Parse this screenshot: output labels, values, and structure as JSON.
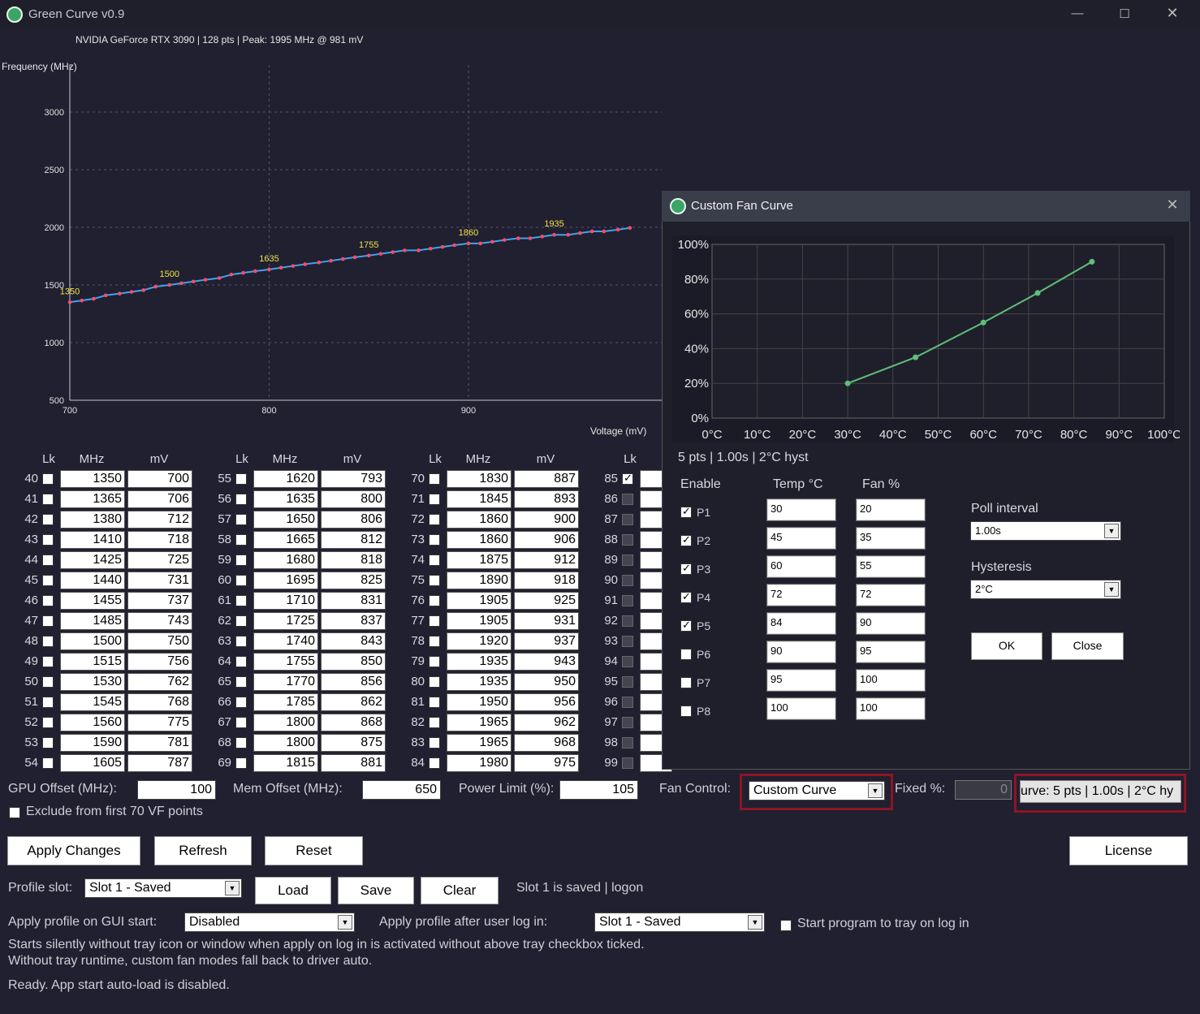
{
  "window": {
    "title": "Green Curve v0.9"
  },
  "info": "NVIDIA GeForce RTX 3090  |  128 pts  |  Peak: 1995 MHz @ 981 mV",
  "chart": {
    "ylabel": "Frequency (MHz)",
    "xlabel": "Voltage (mV)",
    "yticks": [
      "3000",
      "2500",
      "2000",
      "1500",
      "1000",
      "500"
    ],
    "xticks": [
      "700",
      "800",
      "900"
    ],
    "annotations": [
      "1350",
      "1500",
      "1635",
      "1755",
      "1860",
      "1935"
    ]
  },
  "chart_data": {
    "type": "line",
    "xlabel": "Voltage (mV)",
    "ylabel": "Frequency (MHz)",
    "xlim": [
      700,
      995
    ],
    "ylim": [
      500,
      3250
    ],
    "x": [
      700,
      706,
      712,
      718,
      725,
      731,
      737,
      743,
      750,
      756,
      762,
      768,
      775,
      781,
      787,
      793,
      800,
      806,
      812,
      818,
      825,
      831,
      837,
      843,
      850,
      856,
      862,
      868,
      875,
      881,
      887,
      893,
      900,
      906,
      912,
      918,
      925,
      931,
      937,
      943,
      950,
      956,
      962,
      968,
      975,
      981
    ],
    "y": [
      1350,
      1365,
      1380,
      1410,
      1425,
      1440,
      1455,
      1485,
      1500,
      1515,
      1530,
      1545,
      1560,
      1590,
      1605,
      1620,
      1635,
      1650,
      1665,
      1680,
      1695,
      1710,
      1725,
      1740,
      1755,
      1770,
      1785,
      1800,
      1800,
      1815,
      1830,
      1845,
      1860,
      1860,
      1875,
      1890,
      1905,
      1905,
      1920,
      1935,
      1935,
      1950,
      1965,
      1965,
      1980,
      1995
    ]
  },
  "table": {
    "headers": {
      "lk": "Lk",
      "mhz": "MHz",
      "mv": "mV"
    },
    "columns": [
      {
        "rows": [
          {
            "n": "40",
            "mhz": "1350",
            "mv": "700"
          },
          {
            "n": "41",
            "mhz": "1365",
            "mv": "706"
          },
          {
            "n": "42",
            "mhz": "1380",
            "mv": "712"
          },
          {
            "n": "43",
            "mhz": "1410",
            "mv": "718"
          },
          {
            "n": "44",
            "mhz": "1425",
            "mv": "725"
          },
          {
            "n": "45",
            "mhz": "1440",
            "mv": "731"
          },
          {
            "n": "46",
            "mhz": "1455",
            "mv": "737"
          },
          {
            "n": "47",
            "mhz": "1485",
            "mv": "743"
          },
          {
            "n": "48",
            "mhz": "1500",
            "mv": "750"
          },
          {
            "n": "49",
            "mhz": "1515",
            "mv": "756"
          },
          {
            "n": "50",
            "mhz": "1530",
            "mv": "762"
          },
          {
            "n": "51",
            "mhz": "1545",
            "mv": "768"
          },
          {
            "n": "52",
            "mhz": "1560",
            "mv": "775"
          },
          {
            "n": "53",
            "mhz": "1590",
            "mv": "781"
          },
          {
            "n": "54",
            "mhz": "1605",
            "mv": "787"
          }
        ]
      },
      {
        "rows": [
          {
            "n": "55",
            "mhz": "1620",
            "mv": "793"
          },
          {
            "n": "56",
            "mhz": "1635",
            "mv": "800"
          },
          {
            "n": "57",
            "mhz": "1650",
            "mv": "806"
          },
          {
            "n": "58",
            "mhz": "1665",
            "mv": "812"
          },
          {
            "n": "59",
            "mhz": "1680",
            "mv": "818"
          },
          {
            "n": "60",
            "mhz": "1695",
            "mv": "825"
          },
          {
            "n": "61",
            "mhz": "1710",
            "mv": "831"
          },
          {
            "n": "62",
            "mhz": "1725",
            "mv": "837"
          },
          {
            "n": "63",
            "mhz": "1740",
            "mv": "843"
          },
          {
            "n": "64",
            "mhz": "1755",
            "mv": "850"
          },
          {
            "n": "65",
            "mhz": "1770",
            "mv": "856"
          },
          {
            "n": "66",
            "mhz": "1785",
            "mv": "862"
          },
          {
            "n": "67",
            "mhz": "1800",
            "mv": "868"
          },
          {
            "n": "68",
            "mhz": "1800",
            "mv": "875"
          },
          {
            "n": "69",
            "mhz": "1815",
            "mv": "881"
          }
        ]
      },
      {
        "rows": [
          {
            "n": "70",
            "mhz": "1830",
            "mv": "887"
          },
          {
            "n": "71",
            "mhz": "1845",
            "mv": "893"
          },
          {
            "n": "72",
            "mhz": "1860",
            "mv": "900"
          },
          {
            "n": "73",
            "mhz": "1860",
            "mv": "906"
          },
          {
            "n": "74",
            "mhz": "1875",
            "mv": "912"
          },
          {
            "n": "75",
            "mhz": "1890",
            "mv": "918"
          },
          {
            "n": "76",
            "mhz": "1905",
            "mv": "925"
          },
          {
            "n": "77",
            "mhz": "1905",
            "mv": "931"
          },
          {
            "n": "78",
            "mhz": "1920",
            "mv": "937"
          },
          {
            "n": "79",
            "mhz": "1935",
            "mv": "943"
          },
          {
            "n": "80",
            "mhz": "1935",
            "mv": "950"
          },
          {
            "n": "81",
            "mhz": "1950",
            "mv": "956"
          },
          {
            "n": "82",
            "mhz": "1965",
            "mv": "962"
          },
          {
            "n": "83",
            "mhz": "1965",
            "mv": "968"
          },
          {
            "n": "84",
            "mhz": "1980",
            "mv": "975"
          }
        ]
      }
    ],
    "col4_nums": [
      "85",
      "86",
      "87",
      "88",
      "89",
      "90",
      "91",
      "92",
      "93",
      "94",
      "95",
      "96",
      "97",
      "98",
      "99"
    ]
  },
  "controls": {
    "gpu_offset_label": "GPU Offset (MHz):",
    "gpu_offset": "100",
    "mem_offset_label": "Mem Offset (MHz):",
    "mem_offset": "650",
    "power_label": "Power Limit (%):",
    "power": "105",
    "fan_label": "Fan Control:",
    "fan_mode": "Custom Curve",
    "fixed_label": "Fixed %:",
    "fixed_value": "0",
    "fan_summary": "urve: 5 pts | 1.00s | 2°C hy",
    "exclude_label": "Exclude from first 70 VF points",
    "apply": "Apply Changes",
    "refresh": "Refresh",
    "reset": "Reset",
    "license": "License",
    "profile_label": "Profile slot:",
    "profile_value": "Slot 1 - Saved",
    "load": "Load",
    "save": "Save",
    "clear": "Clear",
    "slot_status": "Slot 1 is saved | logon",
    "apply_gui_label": "Apply profile on GUI start:",
    "apply_gui_value": "Disabled",
    "apply_login_label": "Apply profile after user log in:",
    "apply_login_value": "Slot 1 - Saved",
    "tray_label": "Start program to tray on log in",
    "note1": "Starts silently without tray icon or window when apply on log in is activated without above tray checkbox ticked.",
    "note2": "Without tray runtime, custom fan modes fall back to driver auto.",
    "status": "Ready. App start auto-load is disabled."
  },
  "fan_dialog": {
    "title": "Custom Fan Curve",
    "yticks": [
      "100%",
      "80%",
      "60%",
      "40%",
      "20%",
      "0%"
    ],
    "xticks": [
      "0°C",
      "10°C",
      "20°C",
      "30°C",
      "40°C",
      "50°C",
      "60°C",
      "70°C",
      "80°C",
      "90°C",
      "100°C"
    ],
    "summary": "5 pts | 1.00s | 2°C hyst",
    "enable_hdr": "Enable",
    "temp_hdr": "Temp °C",
    "fan_hdr": "Fan %",
    "points": [
      {
        "label": "P1",
        "enabled": true,
        "temp": "30",
        "fan": "20"
      },
      {
        "label": "P2",
        "enabled": true,
        "temp": "45",
        "fan": "35"
      },
      {
        "label": "P3",
        "enabled": true,
        "temp": "60",
        "fan": "55"
      },
      {
        "label": "P4",
        "enabled": true,
        "temp": "72",
        "fan": "72"
      },
      {
        "label": "P5",
        "enabled": true,
        "temp": "84",
        "fan": "90"
      },
      {
        "label": "P6",
        "enabled": false,
        "temp": "90",
        "fan": "95"
      },
      {
        "label": "P7",
        "enabled": false,
        "temp": "95",
        "fan": "100"
      },
      {
        "label": "P8",
        "enabled": false,
        "temp": "100",
        "fan": "100"
      }
    ],
    "poll_label": "Poll interval",
    "poll_value": "1.00s",
    "hyst_label": "Hysteresis",
    "hyst_value": "2°C",
    "ok": "OK",
    "close": "Close",
    "colors": {
      "curve": "#5fbf7a",
      "grid": "#444"
    }
  }
}
